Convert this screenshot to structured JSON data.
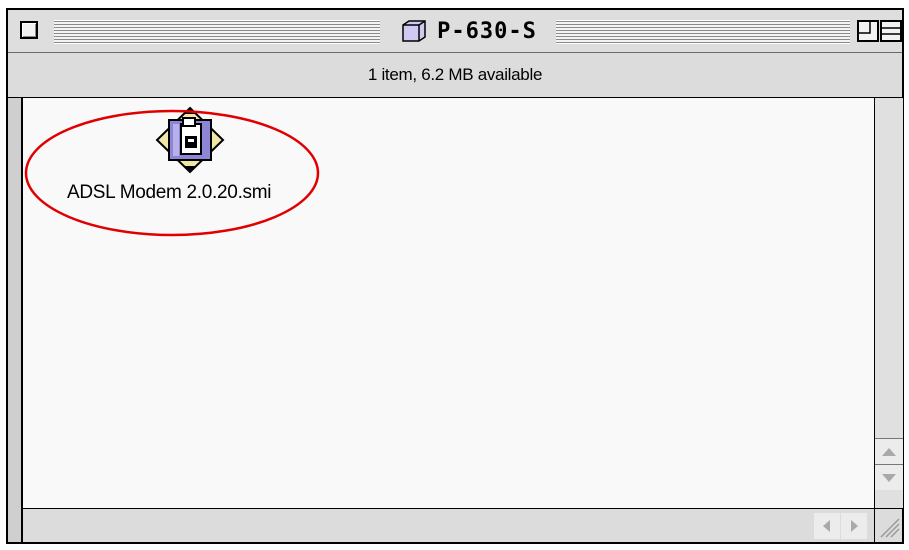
{
  "window": {
    "title": "P-630-S",
    "status": "1 item, 6.2 MB available"
  },
  "icons": {
    "close": "close-box-icon",
    "folder": "folder-icon",
    "zoom": "zoom-box-icon",
    "windowshade": "windowshade-box-icon",
    "file": "disk-image-icon"
  },
  "files": [
    {
      "name": "ADSL Modem 2.0.20.smi",
      "type": "self-mounting image"
    }
  ],
  "colors": {
    "annotation": "#e00000",
    "icon_fill": "#8d85d6"
  }
}
